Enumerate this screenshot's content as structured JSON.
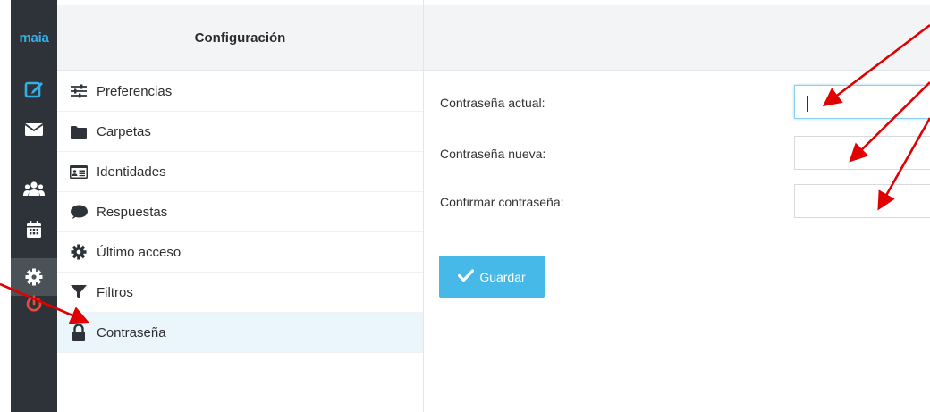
{
  "app": {
    "logo": "maia"
  },
  "colors": {
    "accent": "#47b9e8",
    "rail": "#2d3339",
    "logout": "#e74c3c",
    "annotation": "#e00000"
  },
  "rail_icons": [
    "compose-icon",
    "mail-icon",
    "contacts-icon",
    "calendar-icon",
    "settings-icon",
    "power-icon"
  ],
  "panel": {
    "title": "Configuración"
  },
  "menu": {
    "items": [
      {
        "label": "Preferencias",
        "icon": "sliders-icon"
      },
      {
        "label": "Carpetas",
        "icon": "folder-icon"
      },
      {
        "label": "Identidades",
        "icon": "id-card-icon"
      },
      {
        "label": "Respuestas",
        "icon": "comment-icon"
      },
      {
        "label": "Último acceso",
        "icon": "gear-icon"
      },
      {
        "label": "Filtros",
        "icon": "filter-icon"
      },
      {
        "label": "Contraseña",
        "icon": "lock-icon",
        "active": true
      }
    ]
  },
  "form": {
    "current_label": "Contraseña actual:",
    "current_value": "",
    "new_label": "Contraseña nueva:",
    "new_value": "",
    "confirm_label": "Confirmar contraseña:",
    "confirm_value": "",
    "save_label": "Guardar"
  }
}
